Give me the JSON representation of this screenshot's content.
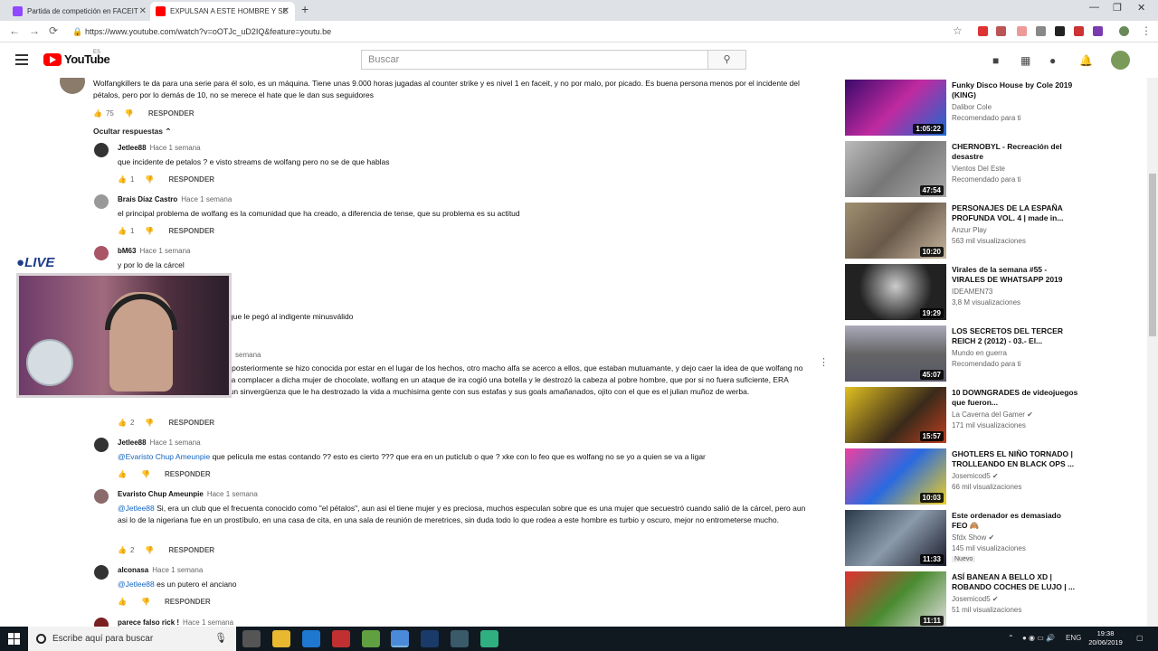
{
  "browser": {
    "tabs": [
      {
        "label": "Partida de competición en FACEIT",
        "active": false,
        "color": "#9146ff"
      },
      {
        "label": "EXPULSAN A ESTE HOMBRE Y SE",
        "active": true,
        "color": "#ff0000"
      }
    ],
    "url": "https://www.youtube.com/watch?v=oOTJc_uD2IQ&feature=youtu.be"
  },
  "youtube": {
    "logo_text": "YouTube",
    "logo_region": "ES",
    "search_placeholder": "Buscar"
  },
  "comments": [
    {
      "author": "",
      "time": "",
      "text": "Wolfangkillers te da para una serie para él solo, es un máquina. Tiene unas 9.000 horas jugadas al counter strike y es nivel 1 en faceit, y no por malo, por picado. Es buena persona menos por el incidente del pétalos, pero por lo demás de 10, no se merece el hate que le dan sus seguidores",
      "likes": "75",
      "reply_label": "RESPONDER"
    }
  ],
  "hide_replies_label": "Ocultar respuestas",
  "replies": [
    {
      "author": "Jetlee88",
      "time": "Hace 1 semana",
      "mention": "",
      "text": "que incidente de petalos ? e visto streams de wolfang pero no se de que hablas",
      "likes": "1",
      "reply_label": "RESPONDER"
    },
    {
      "author": "Brais Díaz Castro",
      "time": "Hace 1 semana",
      "mention": "",
      "text": "el principal problema de wolfang es la comunidad que ha creado, a diferencia de tense, que su problema es su actitud",
      "likes": "1",
      "reply_label": "RESPONDER"
    },
    {
      "author": "bM63",
      "time": "Hace 1 semana",
      "mention": "",
      "text": "y por lo de la cárcel",
      "likes": "",
      "reply_label": ""
    },
    {
      "author": "",
      "time": "",
      "mention": "",
      "text": "que le pegó al indigente minusválido",
      "likes": "",
      "reply_label": ""
    },
    {
      "author": "",
      "time": "semana",
      "mention": "",
      "text": "filtreando con una nigeriana, que posteriormente se hizo conocida por estar en el lugar de los hechos, otro macho alfa se acerco a ellos, que estaban mutuamante, y dejo caer la idea de que wolfang no era lo suficientemente macho para complacer a dicha mujer de chocolate, wolfang en un ataque de ira cogió una botella y le destrozó la cabeza al pobre hombre, que por si no fuera suficiente, ERA MINUSVALIDO, este hombre es un sinvergüenza que le ha destrozado la vida a muchisima gente con sus estafas y sus goals amañanados, ojito con el que es el julian muñoz de werba.",
      "likes": "2",
      "reply_label": "RESPONDER"
    },
    {
      "author": "Jetlee88",
      "time": "Hace 1 semana",
      "mention": "@Evaristo Chup Ameunpie",
      "text": "que pelicula me estas contando ?? esto es cierto ??? que era en un puticlub o que ? xke con lo feo que es wolfang no se yo a quien se va a ligar",
      "likes": "",
      "reply_label": "RESPONDER"
    },
    {
      "author": "Evaristo Chup Ameunpie",
      "time": "Hace 1 semana",
      "mention": "@Jetlee88",
      "text": "Si, era un club que el frecuenta conocido como \"el pétalos\", aun asi el tiene mujer y es preciosa, muchos especulan sobre que es una mujer que secuestró cuando salió de la cárcel, pero aun asi lo de la nigeriana fue en un prostíbulo, en una casa de cita, en una sala de reunión de meretrices, sin duda todo lo que rodea a este hombre es turbio y oscuro, mejor no entrometerse mucho.",
      "likes": "2",
      "reply_label": "RESPONDER"
    },
    {
      "author": "alconasa",
      "time": "Hace 1 semana",
      "mention": "@Jetlee88",
      "text": "es un putero el anciano",
      "likes": "",
      "reply_label": "RESPONDER"
    },
    {
      "author": "parece falso rick !",
      "time": "Hace 1 semana",
      "mention": "",
      "text": "",
      "likes": "",
      "reply_label": ""
    }
  ],
  "overlay": {
    "live_label": "LIVE"
  },
  "recommendations": [
    {
      "title": "Funky Disco House by Cole 2019 (KING)",
      "channel": "Dalibor Cole",
      "meta": "Recomendado para ti",
      "duration": "1:05:22",
      "badge": "",
      "thumb": "#6a2a9a"
    },
    {
      "title": "CHERNOBYL - Recreación del desastre",
      "channel": "Vientos Del Este",
      "meta": "Recomendado para ti",
      "duration": "47:54",
      "badge": "",
      "thumb": "#9a9a8a"
    },
    {
      "title": "PERSONAJES DE LA ESPAÑA PROFUNDA VOL. 4 | made in...",
      "channel": "Anzur Play",
      "meta": "563 mil visualizaciones",
      "duration": "10:20",
      "badge": "",
      "thumb": "#8a7a6a"
    },
    {
      "title": "Virales de la semana #55 - VIRALES DE WHATSAPP 2019",
      "channel": "IDEAMEN73",
      "meta": "3,8 M visualizaciones",
      "duration": "19:29",
      "badge": "",
      "thumb": "#2a2a2a"
    },
    {
      "title": "LOS SECRETOS DEL TERCER REICH 2 (2012) - 03.- El...",
      "channel": "Mundo en guerra",
      "meta": "Recomendado para ti",
      "duration": "45:07",
      "badge": "",
      "thumb": "#6a6a6a"
    },
    {
      "title": "10 DOWNGRADES de videojuegos que fueron...",
      "channel": "La Caverna del Gamer",
      "meta": "171 mil visualizaciones",
      "duration": "15:57",
      "badge": "",
      "thumb": "#c8b020"
    },
    {
      "title": "GHOTLERS EL NIÑO TORNADO | TROLLEANDO EN BLACK OPS ...",
      "channel": "Josemicod5",
      "meta": "66 mil visualizaciones",
      "duration": "10:03",
      "badge": "",
      "thumb": "#e03080"
    },
    {
      "title": "Este ordenador es demasiado FEO 🙈",
      "channel": "Sfdx Show",
      "meta": "145 mil visualizaciones",
      "duration": "11:33",
      "badge": "Nuevo",
      "thumb": "#3a4a5a"
    },
    {
      "title": "ASÍ BANEAN A BELLO XD | ROBANDO COCHES DE LUJO | ...",
      "channel": "Josemicod5",
      "meta": "51 mil visualizaciones",
      "duration": "11:11",
      "badge": "",
      "thumb": "#c03030"
    }
  ],
  "taskbar": {
    "search_placeholder": "Escribe aquí para buscar",
    "lang": "ENG",
    "time": "19:38",
    "date": "20/06/2019"
  }
}
